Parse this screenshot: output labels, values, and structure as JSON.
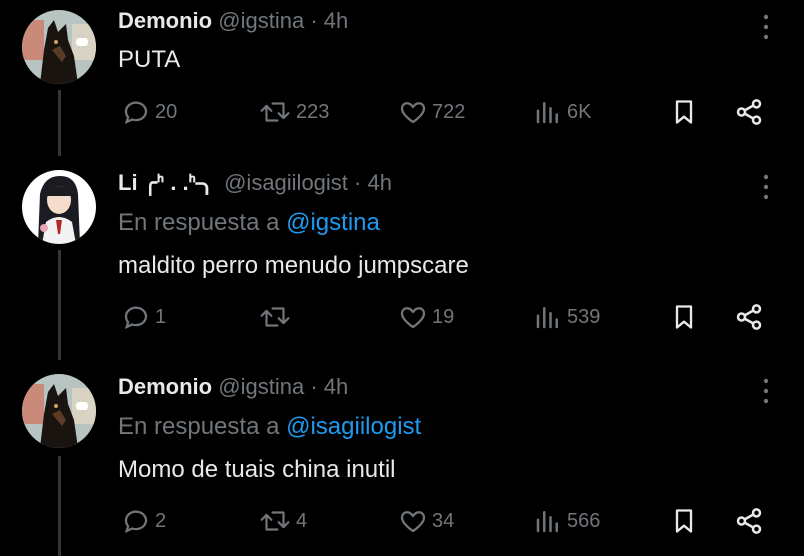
{
  "tweets": [
    {
      "name": "Demonio",
      "handle": "@igstina",
      "sep": "·",
      "time": "4h",
      "reply_prefix": "",
      "reply_handle": "",
      "text": "PUTA",
      "replies": "20",
      "reposts": "223",
      "likes": "722",
      "views": "6K",
      "avatar": "dog-avatar"
    },
    {
      "name": "Li ╭ᑋ . .ᑋ╮",
      "handle": "@isagiilogist",
      "sep": "·",
      "time": "4h",
      "reply_prefix": "En respuesta a ",
      "reply_handle": "@igstina",
      "text": "maldito perro menudo jumpscare",
      "replies": "1",
      "reposts": "",
      "likes": "19",
      "views": "539",
      "avatar": "anime-girl-avatar"
    },
    {
      "name": "Demonio",
      "handle": "@igstina",
      "sep": "·",
      "time": "4h",
      "reply_prefix": "En respuesta a ",
      "reply_handle": "@isagiilogist",
      "text": "Momo de tuais china inutil",
      "replies": "2",
      "reposts": "4",
      "likes": "34",
      "views": "566",
      "avatar": "dog-avatar"
    }
  ],
  "colors": {
    "background": "#000000",
    "text": "#e7e9ea",
    "muted": "#71767b",
    "link": "#1d9bf0",
    "thread_line": "#333639"
  },
  "icons": [
    "reply-icon",
    "repost-icon",
    "like-icon",
    "views-icon",
    "bookmark-icon",
    "share-icon",
    "more-icon"
  ]
}
